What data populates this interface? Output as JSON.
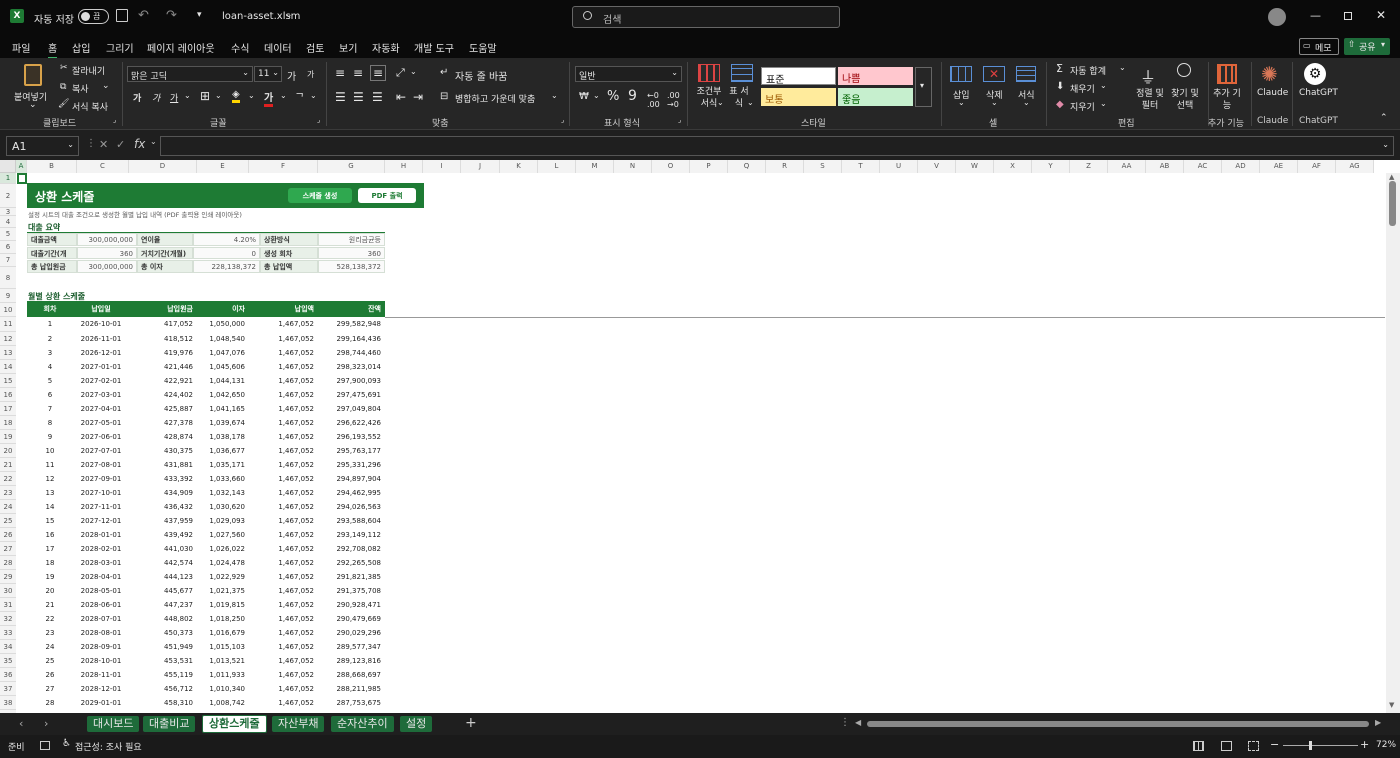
{
  "titlebar": {
    "autosave_label": "자동 저장",
    "autosave_state": "끔",
    "filename": "loan-asset.xlsm",
    "search_placeholder": "검색"
  },
  "menu": {
    "items": [
      "파일",
      "홈",
      "삽입",
      "그리기",
      "페이지 레이아웃",
      "수식",
      "데이터",
      "검토",
      "보기",
      "자동화",
      "개발 도구",
      "도움말"
    ],
    "active": "홈",
    "memo": "메모",
    "share": "공유"
  },
  "ribbon": {
    "clipboard": {
      "paste": "붙여넣기",
      "cut": "잘라내기",
      "copy": "복사",
      "format_copy": "서식 복사",
      "label": "클립보드"
    },
    "font": {
      "name": "맑은 고딕",
      "size": "11",
      "label": "글꼴",
      "grow": "가",
      "shrink": "가"
    },
    "align": {
      "wrap": "자동 줄 바꿈",
      "merge": "병합하고 가운데 맞춤",
      "label": "맞춤"
    },
    "number": {
      "format": "일반",
      "label": "표시 형식"
    },
    "styles": {
      "cond": "조건부 서식",
      "table": "표 서식",
      "normal": "표준",
      "bad": "나쁨",
      "neutral": "보통",
      "good": "좋음",
      "label": "스타일"
    },
    "cells": {
      "insert": "삽입",
      "delete": "삭제",
      "format": "서식",
      "label": "셀"
    },
    "editing": {
      "autosum": "자동 합계",
      "fill": "채우기",
      "clear": "지우기",
      "sort": "정렬 및 필터",
      "find": "찾기 및 선택",
      "label": "편집"
    },
    "addins": {
      "add": "추가 기능",
      "label": "추가 기능"
    },
    "claude": {
      "name": "Claude",
      "label": "Claude"
    },
    "chatgpt": {
      "name": "ChatGPT",
      "label": "ChatGPT"
    }
  },
  "formula_bar": {
    "cell_ref": "A1",
    "value": ""
  },
  "columns": [
    "A",
    "B",
    "C",
    "D",
    "E",
    "F",
    "G",
    "H",
    "I",
    "J",
    "K",
    "L",
    "M",
    "N",
    "O",
    "P",
    "Q",
    "R",
    "S",
    "T",
    "U",
    "V",
    "W",
    "X",
    "Y",
    "Z",
    "AA",
    "AB",
    "AC",
    "AD",
    "AE",
    "AF",
    "AG"
  ],
  "sheet": {
    "title": "상환 스케줄",
    "btn_generate": "스케줄 생성",
    "btn_pdf": "PDF 출력",
    "subtitle": "설정 시트의 대출 조건으로 생성한 월별 납입 내역 (PDF 출력용 인쇄 레이아웃)",
    "summary_title": "대출 요약",
    "summary": [
      [
        "대출금액",
        "300,000,000",
        "연이율",
        "4.20%",
        "상환방식",
        "원리금균등"
      ],
      [
        "대출기간(개",
        "360",
        "거치기간(개월)",
        "0",
        "생성 회차",
        "360"
      ],
      [
        "총 납입원금",
        "300,000,000",
        "총 이자",
        "228,138,372",
        "총 납입액",
        "528,138,372"
      ]
    ],
    "schedule_title": "월별 상환 스케줄",
    "headers": [
      "회차",
      "납입일",
      "납입원금",
      "이자",
      "납입액",
      "잔액"
    ],
    "rows": [
      [
        "1",
        "2026-10-01",
        "417,052",
        "1,050,000",
        "1,467,052",
        "299,582,948"
      ],
      [
        "2",
        "2026-11-01",
        "418,512",
        "1,048,540",
        "1,467,052",
        "299,164,436"
      ],
      [
        "3",
        "2026-12-01",
        "419,976",
        "1,047,076",
        "1,467,052",
        "298,744,460"
      ],
      [
        "4",
        "2027-01-01",
        "421,446",
        "1,045,606",
        "1,467,052",
        "298,323,014"
      ],
      [
        "5",
        "2027-02-01",
        "422,921",
        "1,044,131",
        "1,467,052",
        "297,900,093"
      ],
      [
        "6",
        "2027-03-01",
        "424,402",
        "1,042,650",
        "1,467,052",
        "297,475,691"
      ],
      [
        "7",
        "2027-04-01",
        "425,887",
        "1,041,165",
        "1,467,052",
        "297,049,804"
      ],
      [
        "8",
        "2027-05-01",
        "427,378",
        "1,039,674",
        "1,467,052",
        "296,622,426"
      ],
      [
        "9",
        "2027-06-01",
        "428,874",
        "1,038,178",
        "1,467,052",
        "296,193,552"
      ],
      [
        "10",
        "2027-07-01",
        "430,375",
        "1,036,677",
        "1,467,052",
        "295,763,177"
      ],
      [
        "11",
        "2027-08-01",
        "431,881",
        "1,035,171",
        "1,467,052",
        "295,331,296"
      ],
      [
        "12",
        "2027-09-01",
        "433,392",
        "1,033,660",
        "1,467,052",
        "294,897,904"
      ],
      [
        "13",
        "2027-10-01",
        "434,909",
        "1,032,143",
        "1,467,052",
        "294,462,995"
      ],
      [
        "14",
        "2027-11-01",
        "436,432",
        "1,030,620",
        "1,467,052",
        "294,026,563"
      ],
      [
        "15",
        "2027-12-01",
        "437,959",
        "1,029,093",
        "1,467,052",
        "293,588,604"
      ],
      [
        "16",
        "2028-01-01",
        "439,492",
        "1,027,560",
        "1,467,052",
        "293,149,112"
      ],
      [
        "17",
        "2028-02-01",
        "441,030",
        "1,026,022",
        "1,467,052",
        "292,708,082"
      ],
      [
        "18",
        "2028-03-01",
        "442,574",
        "1,024,478",
        "1,467,052",
        "292,265,508"
      ],
      [
        "19",
        "2028-04-01",
        "444,123",
        "1,022,929",
        "1,467,052",
        "291,821,385"
      ],
      [
        "20",
        "2028-05-01",
        "445,677",
        "1,021,375",
        "1,467,052",
        "291,375,708"
      ],
      [
        "21",
        "2028-06-01",
        "447,237",
        "1,019,815",
        "1,467,052",
        "290,928,471"
      ],
      [
        "22",
        "2028-07-01",
        "448,802",
        "1,018,250",
        "1,467,052",
        "290,479,669"
      ],
      [
        "23",
        "2028-08-01",
        "450,373",
        "1,016,679",
        "1,467,052",
        "290,029,296"
      ],
      [
        "24",
        "2028-09-01",
        "451,949",
        "1,015,103",
        "1,467,052",
        "289,577,347"
      ],
      [
        "25",
        "2028-10-01",
        "453,531",
        "1,013,521",
        "1,467,052",
        "289,123,816"
      ],
      [
        "26",
        "2028-11-01",
        "455,119",
        "1,011,933",
        "1,467,052",
        "288,668,697"
      ],
      [
        "27",
        "2028-12-01",
        "456,712",
        "1,010,340",
        "1,467,052",
        "288,211,985"
      ],
      [
        "28",
        "2029-01-01",
        "458,310",
        "1,008,742",
        "1,467,052",
        "287,753,675"
      ]
    ],
    "row_numbers": [
      "1",
      "2",
      "3",
      "4",
      "5",
      "6",
      "7",
      "8",
      "9",
      "10",
      "11",
      "12",
      "13",
      "14",
      "15",
      "16",
      "17",
      "18",
      "19",
      "20",
      "21",
      "22",
      "23",
      "24",
      "25",
      "26",
      "27",
      "28",
      "29",
      "30",
      "31",
      "32",
      "33",
      "34",
      "35",
      "36",
      "37",
      "38",
      "39"
    ]
  },
  "tabs": [
    "대시보드",
    "대출비교",
    "상환스케줄",
    "자산부채",
    "순자산추이",
    "설정"
  ],
  "active_tab": "상환스케줄",
  "status": {
    "ready": "준비",
    "accessibility": "접근성: 조사 필요",
    "zoom": "72%"
  },
  "colors": {
    "accent": "#1e6b3a",
    "header_green": "#1e7b34"
  }
}
